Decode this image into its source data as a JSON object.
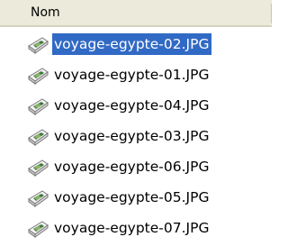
{
  "header": {
    "column_label": "Nom"
  },
  "files": [
    {
      "name": "voyage-egypte-02.JPG",
      "selected": true,
      "icon": "jpg-file-icon"
    },
    {
      "name": "voyage-egypte-01.JPG",
      "selected": false,
      "icon": "jpg-file-icon"
    },
    {
      "name": "voyage-egypte-04.JPG",
      "selected": false,
      "icon": "jpg-file-icon"
    },
    {
      "name": "voyage-egypte-03.JPG",
      "selected": false,
      "icon": "jpg-file-icon"
    },
    {
      "name": "voyage-egypte-06.JPG",
      "selected": false,
      "icon": "jpg-file-icon"
    },
    {
      "name": "voyage-egypte-05.JPG",
      "selected": false,
      "icon": "jpg-file-icon"
    },
    {
      "name": "voyage-egypte-07.JPG",
      "selected": false,
      "icon": "jpg-file-icon"
    }
  ],
  "colors": {
    "selection": "#316ac5",
    "header_bg": "#ebeadb"
  }
}
